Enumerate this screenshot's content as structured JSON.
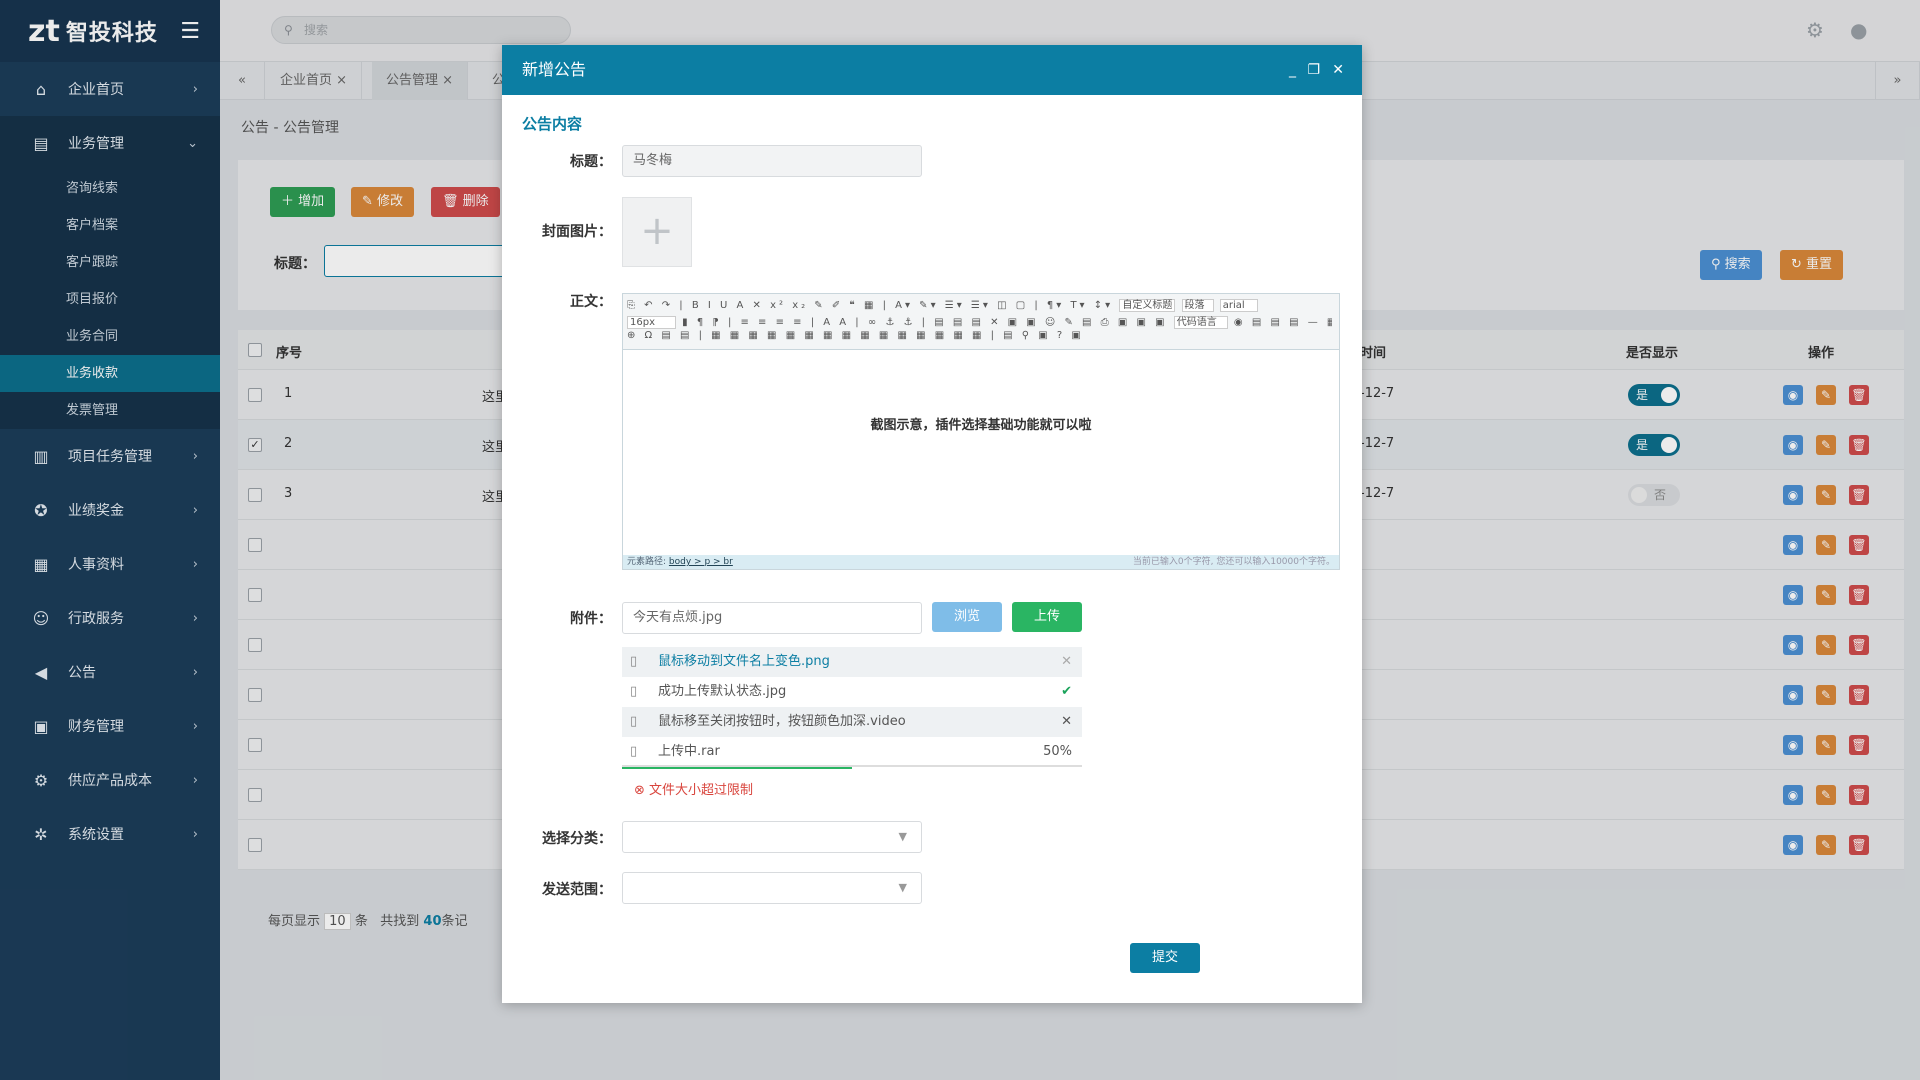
{
  "brand": {
    "mark": "zt",
    "name": "智投科技"
  },
  "sidebar": {
    "items": [
      {
        "label": "企业首页",
        "icon": "home-icon"
      },
      {
        "label": "业务管理",
        "icon": "list-icon"
      },
      {
        "label": "项目任务管理",
        "icon": "clipboard-icon"
      },
      {
        "label": "业绩奖金",
        "icon": "medal-icon"
      },
      {
        "label": "人事资料",
        "icon": "grid-icon"
      },
      {
        "label": "行政服务",
        "icon": "user-icon"
      },
      {
        "label": "公告",
        "icon": "megaphone-icon"
      },
      {
        "label": "财务管理",
        "icon": "wallet-icon"
      },
      {
        "label": "供应产品成本",
        "icon": "gears-icon"
      },
      {
        "label": "系统设置",
        "icon": "settings-icon"
      }
    ],
    "sub_items": [
      "咨询线索",
      "客户档案",
      "客户跟踪",
      "项目报价",
      "业务合同",
      "业务收款",
      "发票管理"
    ]
  },
  "topbar": {
    "search_placeholder": "搜索"
  },
  "tabs": [
    {
      "label": "企业首页"
    },
    {
      "label": "公告管理"
    },
    {
      "label": "公"
    }
  ],
  "breadcrumb": "公告 - 公告管理",
  "toolbar": {
    "add": "增加",
    "edit": "修改",
    "delete": "删除",
    "search": "搜索",
    "reset": "重置"
  },
  "filter": {
    "title_label": "标题："
  },
  "table": {
    "headers": {
      "no": "序号",
      "time": "时间",
      "show": "是否显示",
      "ops": "操作"
    },
    "rows": [
      {
        "no": "1",
        "title": "这里",
        "time": "-12-7",
        "show": "是",
        "on": true,
        "checked": false
      },
      {
        "no": "2",
        "title": "这里",
        "time": "-12-7",
        "show": "是",
        "on": true,
        "checked": true
      },
      {
        "no": "3",
        "title": "这里",
        "time": "-12-7",
        "show": "否",
        "on": false,
        "checked": false
      }
    ],
    "empty_rows": 7
  },
  "pagination": {
    "per_page_label": "每页显示",
    "per_page": "10",
    "unit": "条",
    "found_prefix": "共找到",
    "total": "40",
    "found_suffix": "条记"
  },
  "modal": {
    "title": "新增公告",
    "section": "公告内容",
    "title_label": "标题：",
    "title_value": "马冬梅",
    "cover_label": "封面图片：",
    "body_label": "正文：",
    "editor_font_size": "16px",
    "editor_heading": "自定义标题",
    "editor_paragraph": "段落",
    "editor_font": "arial",
    "editor_code": "代码语言",
    "editor_content": "截图示意，插件选择基础功能就可以啦",
    "editor_path_label": "元素路径:",
    "editor_path": "body > p > br",
    "editor_count": "当前已输入0个字符, 您还可以输入10000个字符。",
    "attach_label": "附件：",
    "attach_value": "今天有点烦.jpg",
    "browse": "浏览",
    "upload": "上传",
    "files": [
      {
        "name": "鼠标移动到文件名上变色.png",
        "state": "hover"
      },
      {
        "name": "成功上传默认状态.jpg",
        "state": "done"
      },
      {
        "name": "鼠标移至关闭按钮时，按钮颜色加深.video",
        "state": "close-hover"
      },
      {
        "name": "上传中.rar",
        "state": "uploading",
        "progress": "50%"
      }
    ],
    "error": "文件大小超过限制",
    "category_label": "选择分类：",
    "scope_label": "发送范围：",
    "submit": "提交"
  }
}
